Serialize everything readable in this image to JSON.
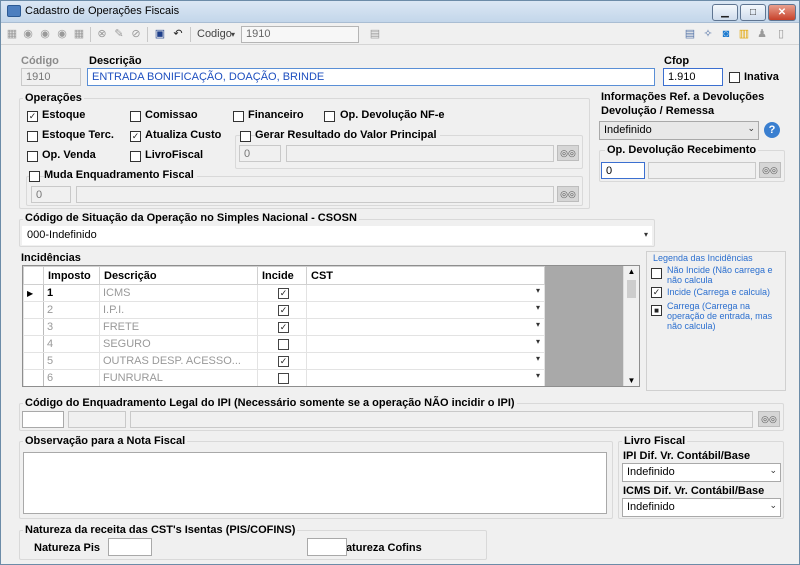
{
  "window": {
    "title": "Cadastro de Operações Fiscais"
  },
  "toolbar": {
    "codigo_label": "Codigo",
    "codigo_value": "1910"
  },
  "header": {
    "codigo_label": "Código",
    "codigo_value": "1910",
    "descricao_label": "Descrição",
    "descricao_value": "ENTRADA BONIFICAÇÃO, DOAÇÃO, BRINDE",
    "cfop_label": "Cfop",
    "cfop_value": "1.910",
    "inativa_label": "Inativa"
  },
  "operacoes": {
    "label": "Operações",
    "estoque": "Estoque",
    "comissao": "Comissao",
    "financeiro": "Financeiro",
    "devolucao": "Op.  Devolução NF-e",
    "estoque_terc": "Estoque Terc.",
    "atualiza_custo": "Atualiza Custo",
    "gerar_resultado": "Gerar Resultado do Valor Principal",
    "gerar_value": "0",
    "op_venda": "Op. Venda",
    "livro_fiscal": "LivroFiscal",
    "muda_enquadramento": "Muda Enquadramento Fiscal",
    "muda_value": "0"
  },
  "info_devolucoes": {
    "label1": "Informações Ref. a Devoluções",
    "label2": "Devolução / Remessa",
    "select_value": "Indefinido",
    "recebimento_label": "Op. Devolução Recebimento",
    "recebimento_value": "0"
  },
  "csosn": {
    "label": "Código de Situação da Operação no Simples Nacional - CSOSN",
    "value": "000-Indefinido"
  },
  "incidencias": {
    "label": "Incidências",
    "columns": [
      "Imposto",
      "Descrição",
      "Incide",
      "CST"
    ],
    "rows": [
      {
        "num": "1",
        "desc": "ICMS",
        "incide": "✓"
      },
      {
        "num": "2",
        "desc": "I.P.I.",
        "incide": "✓"
      },
      {
        "num": "3",
        "desc": "FRETE",
        "incide": "✓"
      },
      {
        "num": "4",
        "desc": "SEGURO",
        "incide": ""
      },
      {
        "num": "5",
        "desc": "OUTRAS DESP. ACESSO...",
        "incide": "✓"
      },
      {
        "num": "6",
        "desc": "FUNRURAL",
        "incide": ""
      }
    ]
  },
  "legenda": {
    "title": "Legenda das Incidências",
    "item1": "Não Incide (Não carrega e não calcula",
    "item2": "Incide (Carrega e calcula)",
    "item3": "Carrega (Carrega na operação de entrada, mas não calcula)"
  },
  "enquadramento": {
    "label": "Código do Enquadramento Legal do IPI (Necessário somente se a operação NÃO incidir o IPI)"
  },
  "observacao": {
    "label": "Observação para a Nota Fiscal"
  },
  "livro_fiscal": {
    "label": "Livro Fiscal",
    "ipi_label": "IPI Dif. Vr. Contábil/Base",
    "ipi_value": "Indefinido",
    "icms_label": "ICMS Dif. Vr. Contábil/Base",
    "icms_value": "Indefinido"
  },
  "natureza": {
    "label": "Natureza da receita das CST's Isentas (PIS/COFINS)",
    "pis_label": "Natureza Pis",
    "cofins_label": "Natureza Cofins"
  }
}
